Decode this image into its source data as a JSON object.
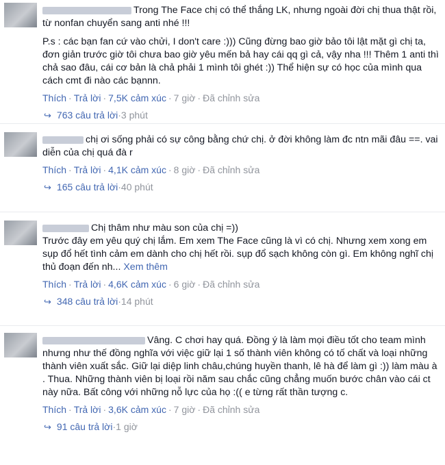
{
  "comments": [
    {
      "text": "Trong The Face chị có thể thắng LK, nhưng ngoài đời chị thua thật rồi, từ nonfan chuyển sang anti nhé !!!",
      "text2": "P.s : các bạn fan cứ vào chửi, I don't care :))) Cũng đừng bao giờ bảo tôi lật mặt gì chị ta, đơn giản trước giờ tôi chưa bao giờ yêu mến bả hay cái qq gì cả, vậy nha !!! Thêm 1 anti thì chả sao đâu, cái cơ bản là chả phải 1 mình tôi ghét :)) Thể hiện sự có học của mình qua cách cmt đi nào các bạnnn.",
      "like": "Thích",
      "reply": "Trả lời",
      "reactions": "7,5K cảm xúc",
      "time": "7 giờ",
      "edited": "Đã chỉnh sửa",
      "replies": "763 câu trả lời",
      "replies_time": "3 phút"
    },
    {
      "text": "chị ơi sống phải có sự công bằng chứ chị. ở đời không làm đc ntn mãi đâu ==. vai diễn của chị quá đà r",
      "like": "Thích",
      "reply": "Trả lời",
      "reactions": "4,1K cảm xúc",
      "time": "8 giờ",
      "edited": "Đã chỉnh sửa",
      "replies": "165 câu trả lời",
      "replies_time": "40 phút"
    },
    {
      "text": "Chị thâm như màu son của chị =))",
      "text2": "Trước đây em yêu quý chị lắm. Em xem The Face cũng là vì có chị. Nhưng xem xong em sụp đổ hết tình cảm em dành cho chị hết rồi. sụp đổ sạch không còn gì. Em không nghĩ chị thủ đoạn đến nh...",
      "see_more": "Xem thêm",
      "like": "Thích",
      "reply": "Trả lời",
      "reactions": "4,6K cảm xúc",
      "time": "6 giờ",
      "edited": "Đã chỉnh sửa",
      "replies": "348 câu trả lời",
      "replies_time": "14 phút"
    },
    {
      "text": "Vâng. C chơi hay quá. Đồng ý là làm mọi điều tốt cho team mình nhưng như thế đồng nghĩa với việc giữ lại 1 số thành viên không có tố chất và loại những thành viên xuất sắc. Giữ lại diệp linh châu,chúng huyền thanh, lê hà để làm gì :)) làm màu à . Thua. Những thành viên bị loại rồi năm sau chắc cũng chẳng muốn bước chân vào cái ct này nữa. Bất công với những nỗ lực của họ :(( e từng rất thần tượng c.",
      "like": "Thích",
      "reply": "Trả lời",
      "reactions": "3,6K cảm xúc",
      "time": "7 giờ",
      "edited": "Đã chỉnh sửa",
      "replies": "91 câu trả lời",
      "replies_time": "1 giờ"
    }
  ]
}
